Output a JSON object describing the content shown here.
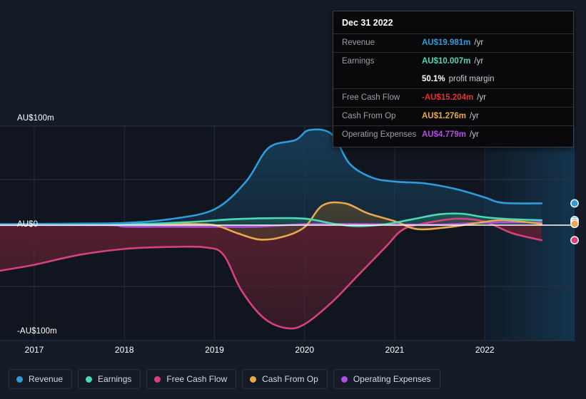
{
  "chart_data": {
    "type": "area",
    "title": "",
    "xlabel": "",
    "ylabel": "",
    "currency": "AU$",
    "units": "m",
    "grid": true,
    "legend_position": "bottom",
    "ylim": [
      -100,
      100
    ],
    "y_ticks": [
      {
        "value": 100,
        "label": "AU$100m"
      },
      {
        "value": 0,
        "label": "AU$0"
      },
      {
        "value": -100,
        "label": "-AU$100m"
      }
    ],
    "x_ticks": [
      "2017",
      "2018",
      "2019",
      "2020",
      "2021",
      "2022"
    ],
    "x_range": [
      2016.62,
      2022.63
    ],
    "forecast_start": "2022",
    "series": [
      {
        "name": "Revenue",
        "color": "#2d9cdb",
        "fill": "#173d57",
        "x": [
          2016.62,
          2017.0,
          2017.5,
          2018.0,
          2018.5,
          2019.0,
          2019.35,
          2019.6,
          2019.9,
          2020.05,
          2020.3,
          2020.5,
          2020.75,
          2021.0,
          2021.35,
          2021.7,
          2022.0,
          2022.2,
          2022.63
        ],
        "values": [
          1.0,
          1.2,
          1.6,
          2.2,
          6.0,
          16.0,
          44.0,
          78.0,
          86.0,
          96.0,
          92.0,
          62.0,
          48.0,
          44.0,
          42.0,
          36.0,
          28.0,
          22.5,
          22.0
        ]
      },
      {
        "name": "Earnings",
        "color": "#4fd8b8",
        "fill": "#1b5e56",
        "x": [
          2016.62,
          2017.0,
          2017.6,
          2018.2,
          2018.8,
          2019.2,
          2019.6,
          2020.0,
          2020.35,
          2020.6,
          2020.9,
          2021.2,
          2021.5,
          2021.75,
          2022.0,
          2022.3,
          2022.63
        ],
        "values": [
          0.6,
          0.7,
          0.9,
          1.2,
          3.5,
          6.0,
          7.0,
          6.6,
          1.0,
          -1.0,
          1.0,
          6.0,
          11.0,
          11.5,
          8.0,
          6.0,
          5.0
        ]
      },
      {
        "name": "Free Cash Flow",
        "color": "#d6417e",
        "fill": "#5a2030",
        "x": [
          2016.62,
          2017.0,
          2017.5,
          2018.0,
          2018.5,
          2018.9,
          2019.1,
          2019.3,
          2019.55,
          2019.8,
          2020.0,
          2020.3,
          2020.6,
          2020.9,
          2021.1,
          2021.4,
          2021.7,
          2022.0,
          2022.3,
          2022.63
        ],
        "values": [
          -46.0,
          -40.0,
          -30.0,
          -24.0,
          -22.0,
          -22.5,
          -30.0,
          -66.0,
          -94.0,
          -104.0,
          -100.0,
          -78.0,
          -50.0,
          -22.0,
          -4.0,
          3.0,
          6.5,
          3.5,
          -8.0,
          -15.2
        ]
      },
      {
        "name": "Cash From Op",
        "color": "#e8a84b",
        "fill": "#4b4330",
        "x": [
          2016.62,
          2017.0,
          2017.6,
          2018.2,
          2018.7,
          2019.0,
          2019.25,
          2019.5,
          2019.75,
          2020.0,
          2020.2,
          2020.45,
          2020.7,
          2021.0,
          2021.25,
          2021.6,
          2021.9,
          2022.2,
          2022.63
        ],
        "values": [
          0.4,
          0.5,
          0.8,
          1.0,
          1.2,
          0.0,
          -8.0,
          -14.5,
          -12.0,
          -2.0,
          20.0,
          22.0,
          12.0,
          4.0,
          -4.0,
          -2.0,
          2.0,
          5.0,
          1.3
        ]
      },
      {
        "name": "Operating Expenses",
        "color": "#b04fe0",
        "fill": "#3d2a55",
        "x": [
          2016.62,
          2017.8,
          2018.0,
          2018.5,
          2019.0,
          2019.5,
          2020.0,
          2020.5,
          2021.0,
          2021.5,
          2022.0,
          2022.63
        ],
        "values": [
          0.0,
          0.0,
          -1.5,
          -1.6,
          -1.7,
          -1.5,
          1.0,
          1.2,
          0.8,
          0.6,
          2.5,
          3.0
        ]
      }
    ],
    "endpoints": [
      {
        "name": "Revenue",
        "value": 22.0,
        "color": "#2d9cdb"
      },
      {
        "name": "Earnings",
        "value": 5.0,
        "color": "#4fd8b8"
      },
      {
        "name": "Operating Expenses",
        "value": 3.0,
        "color": "#b04fe0"
      },
      {
        "name": "Cash From Op",
        "value": 1.3,
        "color": "#e8a84b"
      },
      {
        "name": "Free Cash Flow",
        "value": -15.2,
        "color": "#d6417e"
      }
    ]
  },
  "tooltip": {
    "date": "Dec 31 2022",
    "rows": [
      {
        "key": "Revenue",
        "value": "AU$19.981m",
        "unit": "/yr",
        "color": "#2d9cdb"
      },
      {
        "key": "Earnings",
        "value": "AU$10.007m",
        "unit": "/yr",
        "color": "#4fd8b8"
      },
      {
        "key": "",
        "value": "50.1%",
        "unit": "profit margin",
        "color": "#ffffff"
      },
      {
        "key": "Free Cash Flow",
        "value": "-AU$15.204m",
        "unit": "/yr",
        "color": "#e0342c"
      },
      {
        "key": "Cash From Op",
        "value": "AU$1.276m",
        "unit": "/yr",
        "color": "#e8a84b"
      },
      {
        "key": "Operating Expenses",
        "value": "AU$4.779m",
        "unit": "/yr",
        "color": "#b04fe0"
      }
    ]
  },
  "legend": {
    "items": [
      {
        "label": "Revenue",
        "color": "#2d9cdb"
      },
      {
        "label": "Earnings",
        "color": "#4fd8b8"
      },
      {
        "label": "Free Cash Flow",
        "color": "#d6417e"
      },
      {
        "label": "Cash From Op",
        "color": "#e8a84b"
      },
      {
        "label": "Operating Expenses",
        "color": "#b04fe0"
      }
    ]
  },
  "axis": {
    "y_top_label": "AU$100m",
    "y_zero_label": "AU$0",
    "y_bottom_label": "-AU$100m",
    "x_labels": [
      "2017",
      "2018",
      "2019",
      "2020",
      "2021",
      "2022"
    ]
  }
}
